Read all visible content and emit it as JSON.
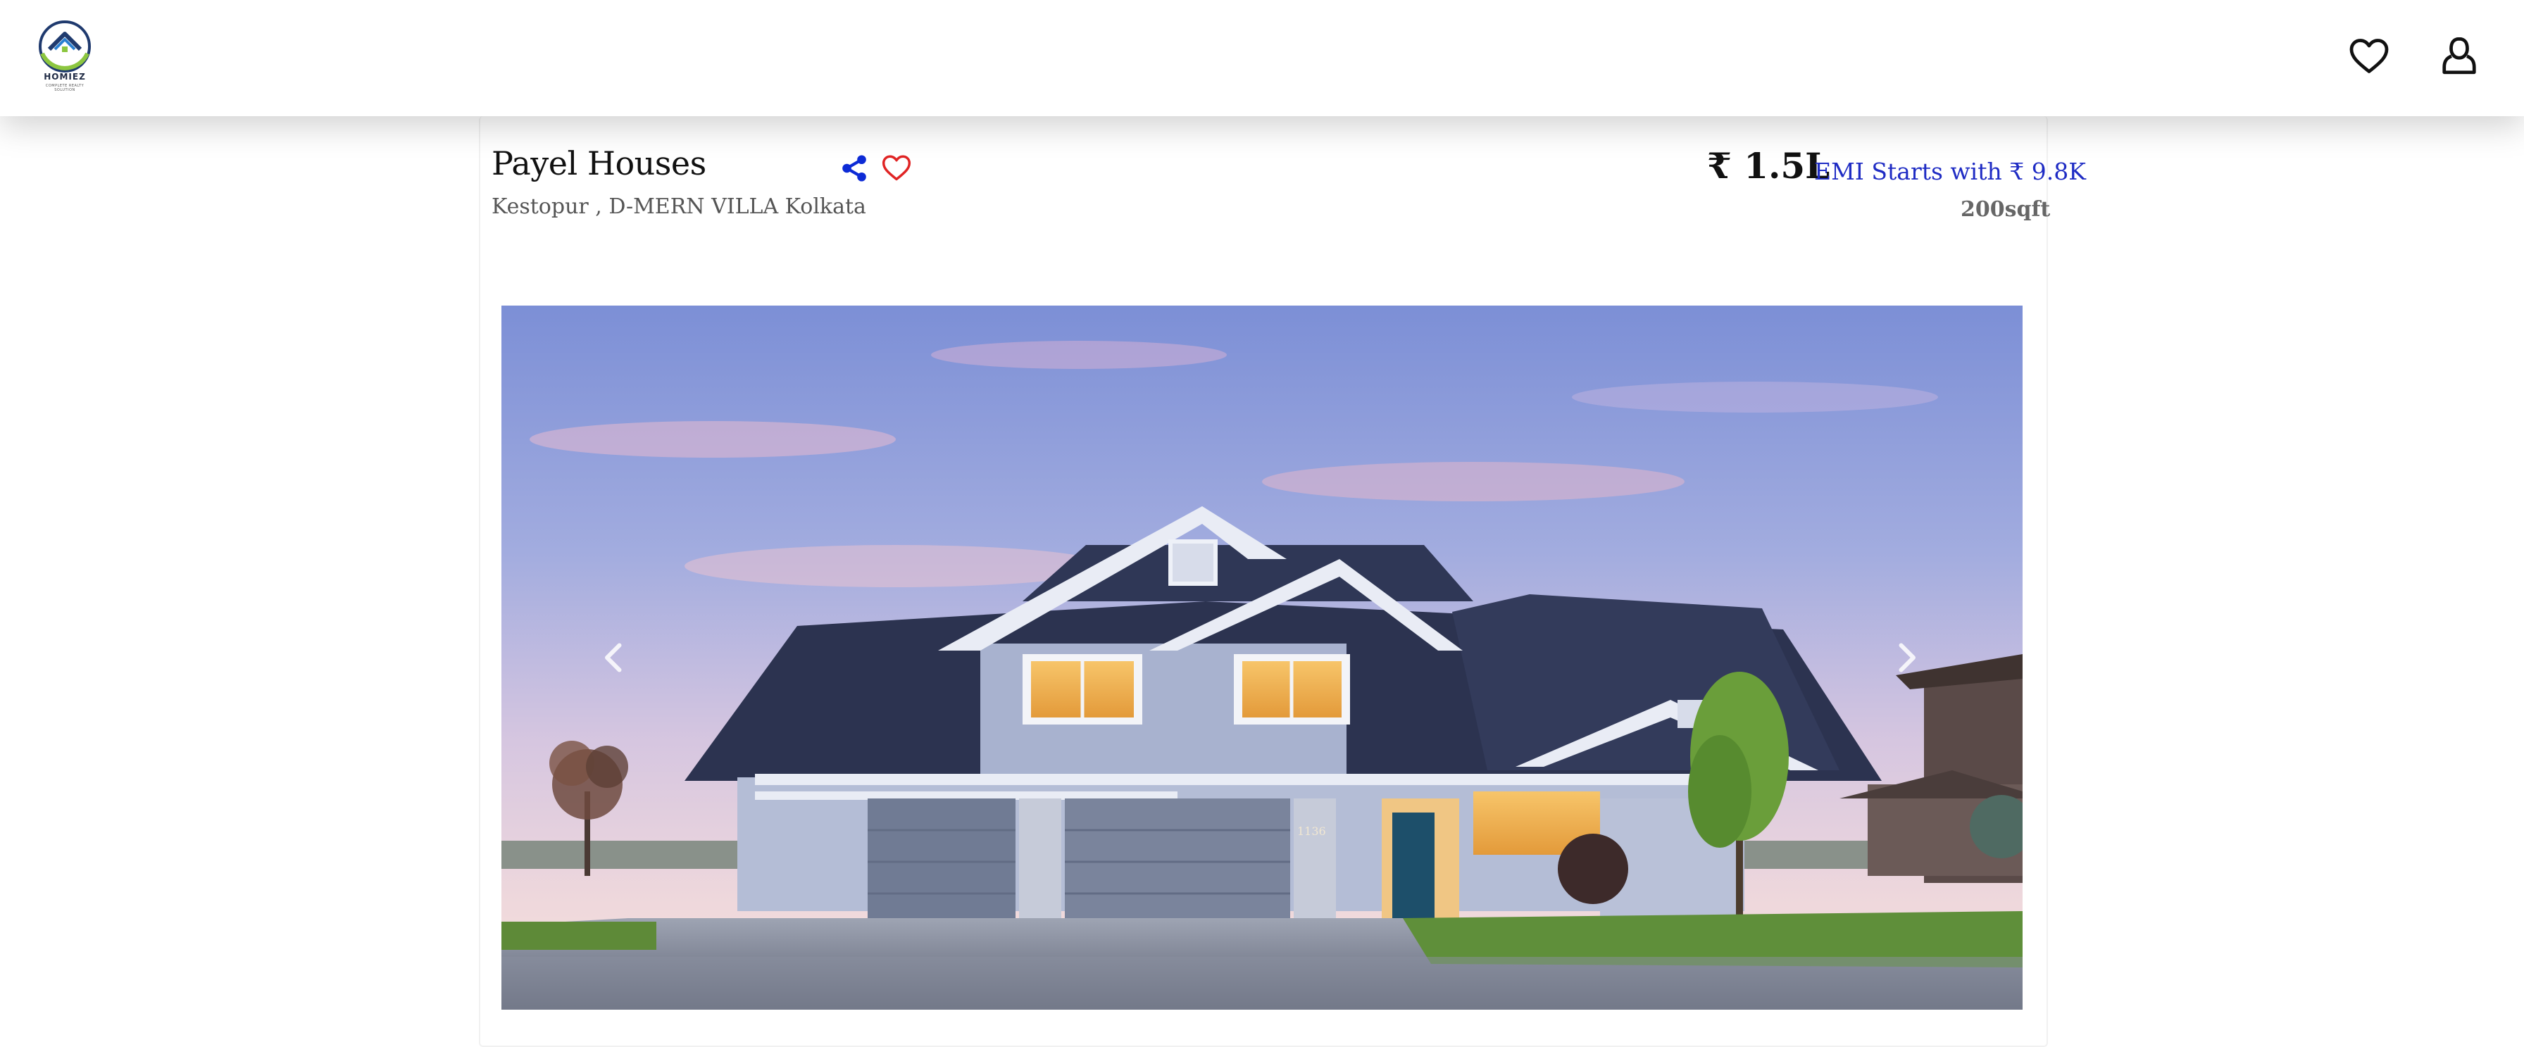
{
  "navbar": {
    "logo": {
      "name": "HOMIEZ",
      "tagline": "COMPLETE REALTY SOLUTION"
    },
    "icons": [
      "heart-icon",
      "user-icon"
    ]
  },
  "property": {
    "title": "Payel Houses",
    "location": "Kestopur , D-MERN VILLA Kolkata",
    "price": "₹ 1.5L",
    "emi_label": "EMI Starts with",
    "emi_value": "₹ 9.8K",
    "area": "200sqft",
    "house_number": "1136"
  },
  "carousel": {
    "prev_icon": "chevron-left-icon",
    "next_icon": "chevron-right-icon"
  },
  "colors": {
    "accent_blue": "#1f2cc4",
    "share_blue": "#0d2bd6",
    "favorite_red": "#e02424",
    "logo_green": "#8cc63f",
    "logo_navy": "#1f3a6e"
  }
}
